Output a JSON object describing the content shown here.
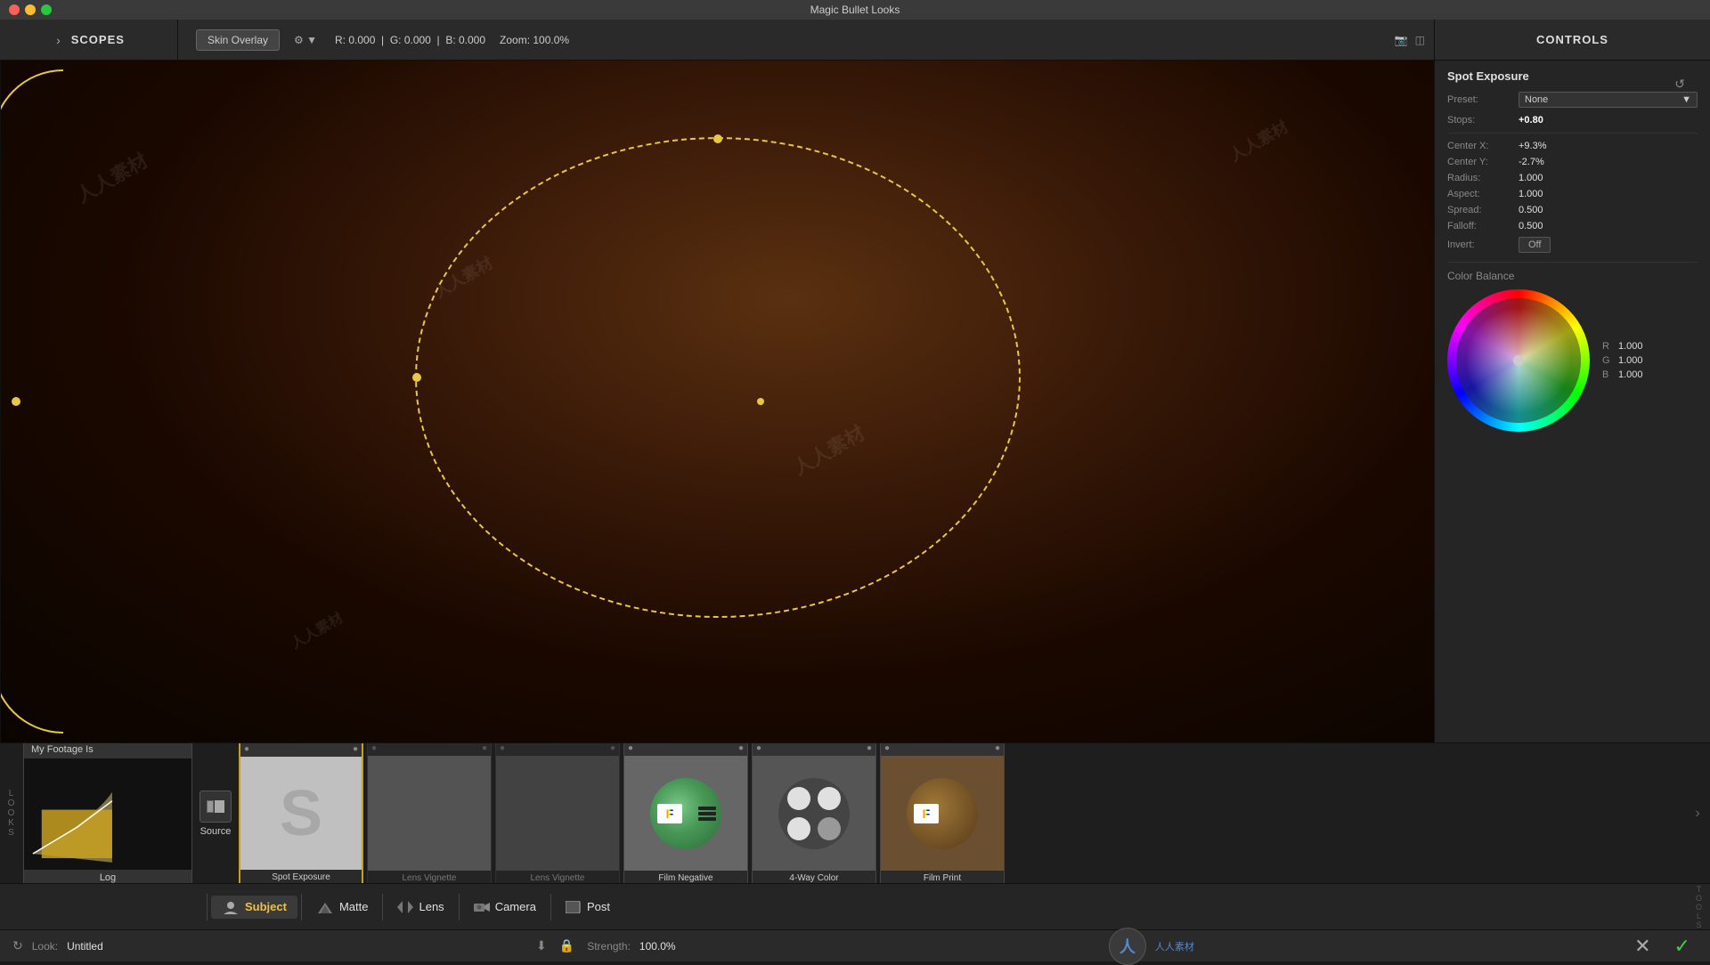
{
  "app": {
    "title": "Magic Bullet Looks"
  },
  "titlebar": {
    "close": "×",
    "minimize": "–",
    "maximize": "+"
  },
  "toolbar": {
    "scopes_label": "SCOPES",
    "skin_overlay": "Skin Overlay",
    "r_value": "R: 0.000",
    "g_value": "G: 0.000",
    "b_value": "B: 0.000",
    "zoom": "Zoom: 100.0%",
    "controls_label": "CONTROLS"
  },
  "controls": {
    "title": "Spot Exposure",
    "preset_label": "Preset:",
    "preset_value": "None",
    "stops_label": "Stops:",
    "stops_value": "+0.80",
    "center_x_label": "Center X:",
    "center_x_value": "+9.3%",
    "center_y_label": "Center Y:",
    "center_y_value": "-2.7%",
    "radius_label": "Radius:",
    "radius_value": "1.000",
    "aspect_label": "Aspect:",
    "aspect_value": "1.000",
    "spread_label": "Spread:",
    "spread_value": "0.500",
    "falloff_label": "Falloff:",
    "falloff_value": "0.500",
    "invert_label": "Invert:",
    "invert_value": "Off",
    "color_balance_label": "Color Balance",
    "r_label": "R",
    "r_val": "1.000",
    "g_label": "G",
    "g_val": "1.000",
    "b_label": "B",
    "b_val": "1.000"
  },
  "source_card": {
    "title": "My Footage Is",
    "label": "Log"
  },
  "bottom_toolbar": {
    "source_label": "Source",
    "subject_label": "Subject",
    "matte_label": "Matte",
    "lens_label": "Lens",
    "camera_label": "Camera",
    "post_label": "Post"
  },
  "effect_cards": [
    {
      "label": "Spot Exposure",
      "type": "spot",
      "active": true
    },
    {
      "label": "Lens Vignette",
      "type": "lens_vignette",
      "active": false
    },
    {
      "label": "Lens Vignette",
      "type": "lens_vignette2",
      "active": false
    },
    {
      "label": "Film Negative",
      "type": "film_neg",
      "active": false
    },
    {
      "label": "4-Way Color",
      "type": "four_way",
      "active": false
    },
    {
      "label": "Film Print",
      "type": "film_print",
      "active": false
    }
  ],
  "footer": {
    "look_label": "Look:",
    "look_name": "Untitled",
    "strength_label": "Strength:",
    "strength_value": "100.0%"
  },
  "looks_letters": [
    "L",
    "O",
    "O",
    "K",
    "S"
  ]
}
